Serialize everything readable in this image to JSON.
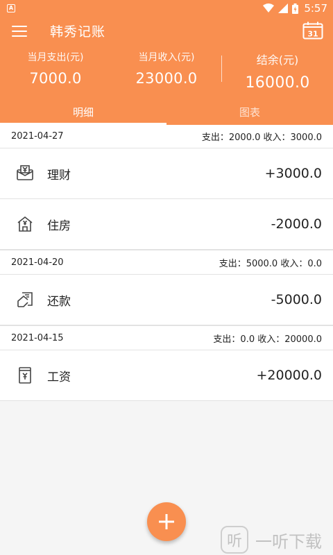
{
  "status_bar": {
    "time": "5:57",
    "app_icon_letter": "A"
  },
  "app": {
    "title": "韩秀记账",
    "menu_icon": "menu-icon",
    "calendar_icon": "calendar-icon",
    "calendar_day": "31"
  },
  "summary": {
    "expense_label": "当月支出(元)",
    "expense_value": "7000.0",
    "income_label": "当月收入(元)",
    "income_value": "23000.0",
    "balance_label": "结余(元)",
    "balance_value": "16000.0"
  },
  "tabs": [
    {
      "label": "明细",
      "active": true
    },
    {
      "label": "图表",
      "active": false
    }
  ],
  "groups": [
    {
      "date": "2021-04-27",
      "summary": "支出：2000.0 收入：3000.0",
      "entries": [
        {
          "name": "理财",
          "amount": "+3000.0",
          "icon": "finance-icon"
        },
        {
          "name": "住房",
          "amount": "-2000.0",
          "icon": "house-icon"
        }
      ]
    },
    {
      "date": "2021-04-20",
      "summary": "支出：5000.0 收入：0.0",
      "entries": [
        {
          "name": "还款",
          "amount": "-5000.0",
          "icon": "repayment-icon"
        }
      ]
    },
    {
      "date": "2021-04-15",
      "summary": "支出：0.0 收入：20000.0",
      "entries": [
        {
          "name": "工资",
          "amount": "+20000.0",
          "icon": "salary-icon"
        }
      ]
    }
  ],
  "fab": {
    "icon": "plus-icon"
  },
  "watermark": {
    "glyph": "听",
    "text": "一听下载"
  },
  "colors": {
    "accent": "#f98f50",
    "background": "#f5f5f5",
    "divider": "#e2e2e2"
  }
}
